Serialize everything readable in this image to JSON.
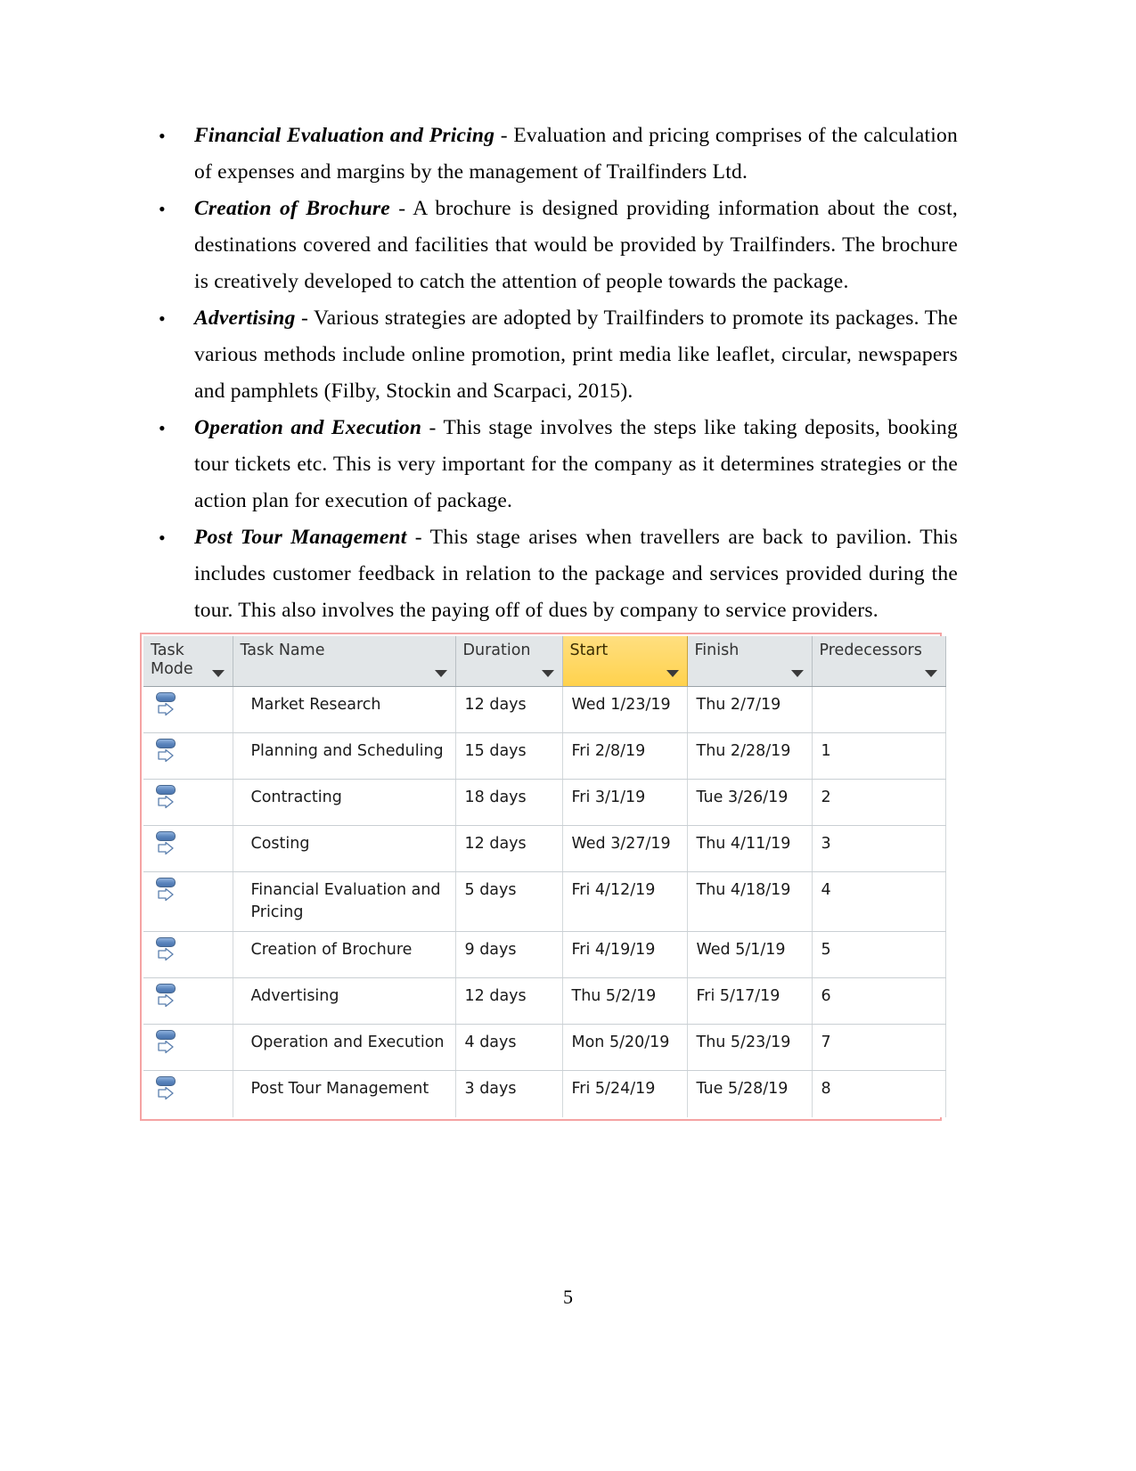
{
  "document": {
    "page_number": "5",
    "bullets": [
      {
        "term": "Financial Evaluation and Pricing",
        "separator": " - ",
        "text": "Evaluation and pricing comprises of the calculation of expenses and margins by the management of Trailfinders Ltd."
      },
      {
        "term": "Creation of Brochure",
        "separator": " - ",
        "text": "A brochure is designed providing information about the cost, destinations covered and facilities that would be provided by Trailfinders. The brochure is creatively developed to catch the attention of people towards the package."
      },
      {
        "term": "Advertising",
        "separator": " - ",
        "text": "Various strategies are adopted by Trailfinders to promote its packages. The various methods include online promotion, print media like leaflet, circular, newspapers and pamphlets (Filby, Stockin and Scarpaci, 2015)."
      },
      {
        "term": "Operation and Execution",
        "separator": " - ",
        "text": "This stage involves the steps like taking deposits, booking tour tickets etc. This is very important for the company as it determines strategies or the action plan for execution of package."
      },
      {
        "term": "Post Tour Management",
        "separator": " - ",
        "text": "This stage arises when travellers are back to pavilion. This includes customer feedback in relation to the package and services provided during the tour. This also involves the paying off of dues by company to service providers."
      }
    ]
  },
  "project_table": {
    "border_color": "#f5a3a3",
    "header_background": "#e2e6e8",
    "highlight_color": "#ffd24d",
    "columns": [
      {
        "label": "Task Mode",
        "filter": true,
        "highlighted": false
      },
      {
        "label": "Task Name",
        "filter": true,
        "highlighted": false
      },
      {
        "label": "Duration",
        "filter": true,
        "highlighted": false
      },
      {
        "label": "Start",
        "filter": true,
        "highlighted": true
      },
      {
        "label": "Finish",
        "filter": true,
        "highlighted": false
      },
      {
        "label": "Predecessors",
        "filter": true,
        "highlighted": false
      }
    ],
    "task_mode_icon": "auto-schedule-icon",
    "rows": [
      {
        "task_name": "Market Research",
        "duration": "12 days",
        "start": "Wed 1/23/19",
        "finish": "Thu 2/7/19",
        "predecessors": ""
      },
      {
        "task_name": "Planning and Scheduling",
        "duration": "15 days",
        "start": "Fri 2/8/19",
        "finish": "Thu 2/28/19",
        "predecessors": "1"
      },
      {
        "task_name": "Contracting",
        "duration": "18 days",
        "start": "Fri 3/1/19",
        "finish": "Tue 3/26/19",
        "predecessors": "2"
      },
      {
        "task_name": "Costing",
        "duration": "12 days",
        "start": "Wed 3/27/19",
        "finish": "Thu 4/11/19",
        "predecessors": "3"
      },
      {
        "task_name": "Financial Evaluation and Pricing",
        "duration": "5 days",
        "start": "Fri 4/12/19",
        "finish": "Thu 4/18/19",
        "predecessors": "4"
      },
      {
        "task_name": "Creation of Brochure",
        "duration": "9 days",
        "start": "Fri 4/19/19",
        "finish": "Wed 5/1/19",
        "predecessors": "5"
      },
      {
        "task_name": "Advertising",
        "duration": "12 days",
        "start": "Thu 5/2/19",
        "finish": "Fri 5/17/19",
        "predecessors": "6"
      },
      {
        "task_name": "Operation and Execution",
        "duration": "4 days",
        "start": "Mon 5/20/19",
        "finish": "Thu 5/23/19",
        "predecessors": "7"
      },
      {
        "task_name": "Post Tour Management",
        "duration": "3 days",
        "start": "Fri 5/24/19",
        "finish": "Tue 5/28/19",
        "predecessors": "8"
      }
    ]
  }
}
